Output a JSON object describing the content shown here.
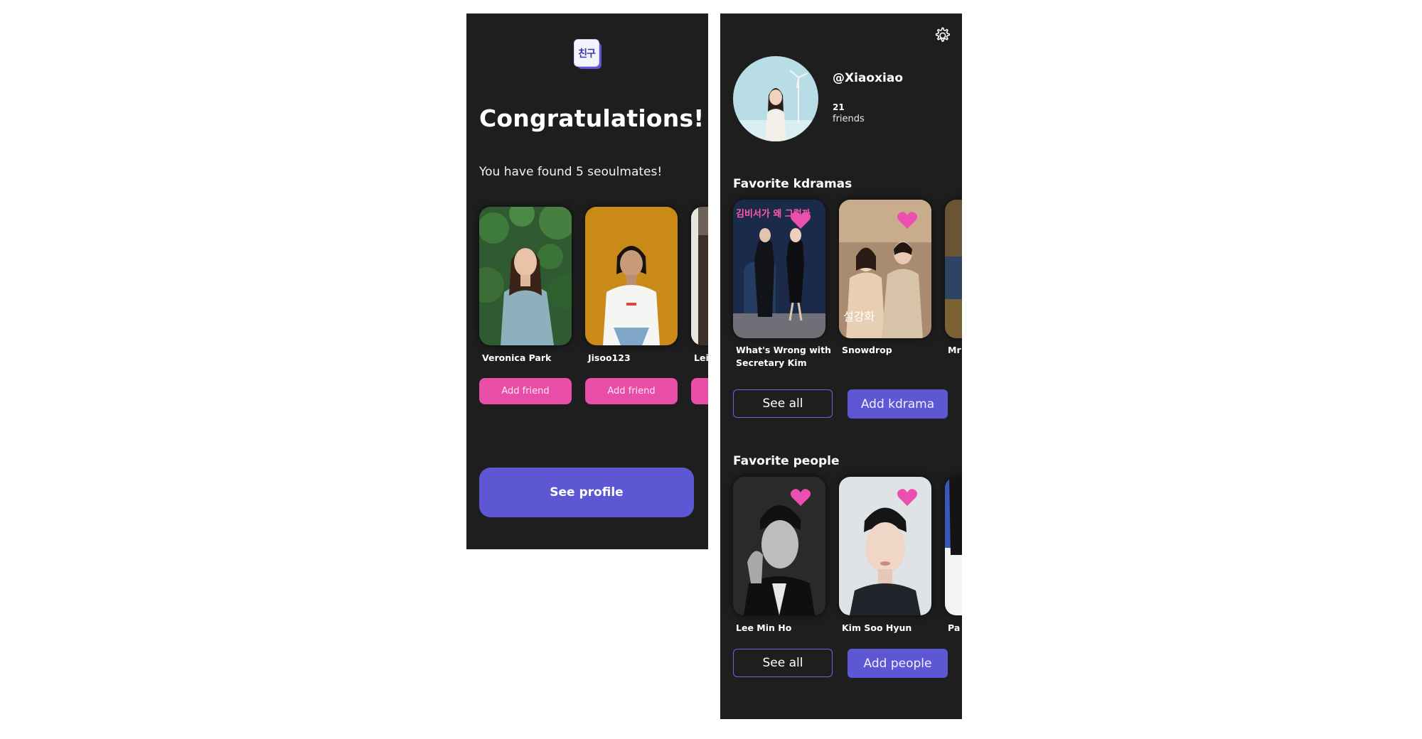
{
  "congrats": {
    "logo_text": "친구",
    "title": "Congratulations!",
    "subtitle": "You have found 5 seoulmates!",
    "matches": [
      {
        "name": "Veronica Park",
        "button": "Add friend"
      },
      {
        "name": "Jisoo123",
        "button": "Add friend"
      },
      {
        "name": "Lei",
        "button": ""
      }
    ],
    "see_profile_label": "See profile"
  },
  "profile": {
    "username": "@Xiaoxiao",
    "friend_count": "21",
    "friend_label": "friends",
    "kdramas": {
      "title": "Favorite kdramas",
      "items": [
        {
          "title": "What's Wrong with Secretary Kim",
          "poster_text": "김비서가 왜 그럴까"
        },
        {
          "title": "Snowdrop",
          "poster_text": "설강화"
        },
        {
          "title": "Mr"
        }
      ],
      "see_all": "See all",
      "add": "Add kdrama"
    },
    "people": {
      "title": "Favorite people",
      "items": [
        {
          "name": "Lee Min Ho"
        },
        {
          "name": "Kim Soo Hyun"
        },
        {
          "name": "Pa"
        }
      ],
      "see_all": "See all",
      "add": "Add people"
    }
  },
  "colors": {
    "background": "#1e1e1f",
    "accent_purple": "#5d57d3",
    "accent_pink": "#e84da8"
  }
}
